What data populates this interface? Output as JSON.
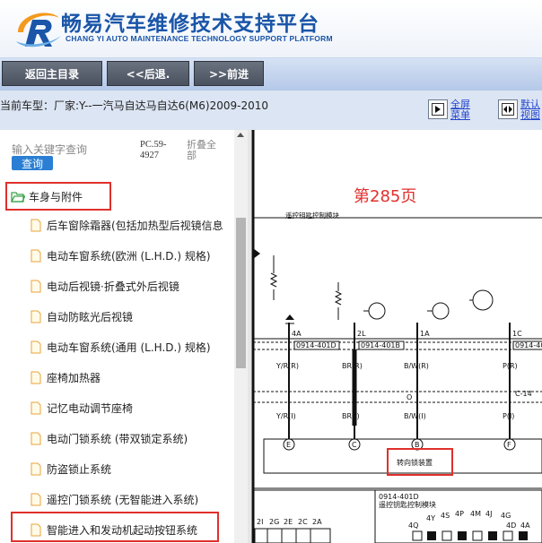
{
  "header": {
    "title_cn": "畅易汽车维修技术支持平台",
    "title_en": "CHANG YI AUTO MAINTENANCE TECHNOLOGY SUPPORT PLATFORM"
  },
  "nav": {
    "home": "返回主目录",
    "back": "<<后退.",
    "forward": ">>前进"
  },
  "vehicle": {
    "text": "当前车型：厂家:Y--一汽马自达马自达6(M6)2009-2010"
  },
  "tools": {
    "fullscreen_line1": "全屏",
    "fullscreen_line2": "菜单",
    "default_line1": "默认",
    "default_line2": "视图"
  },
  "search": {
    "placeholder": "输入关键字查询",
    "button": "查询",
    "pc_line1": "PC.59-",
    "pc_line2": "4927",
    "fold_line1": "折叠全",
    "fold_line2": "部"
  },
  "tree": {
    "root": "车身与附件",
    "items": [
      "后车窗除霜器(包括加热型后视镜信息",
      "电动车窗系统(欧洲 (L.H.D.) 规格)",
      "电动后视镜·折叠式外后视镜",
      "自动防眩光后视镜",
      "电动车窗系统(通用 (L.H.D.) 规格)",
      "座椅加热器",
      "记忆电动调节座椅",
      "电动门锁系统 (带双锁定系统)",
      "防盗锁止系统",
      "遥控门锁系统 (无智能进入系统)",
      "智能进入和发动机起动按钮系统"
    ]
  },
  "diagram": {
    "page": "第285页",
    "section": "遥控钥匙控制模块",
    "pins": [
      "4A",
      "2L",
      "1A",
      "1C"
    ],
    "connectors": [
      "0914-401D",
      "0914-401B",
      "0914-401"
    ],
    "wires_top": [
      "Y/R(R)",
      "BR(R)",
      "B/W(R)",
      "P(R)"
    ],
    "wires_bottom": [
      "Y/R(I)",
      "BR(I)",
      "B/W(I)",
      "P(I)"
    ],
    "terminals": [
      "E",
      "C",
      "B",
      "F"
    ],
    "junction": "C-14",
    "o_label": "O",
    "lock_unit": "转向锁装置",
    "lower_connector": "0914-401D",
    "lower_module": "遥控钥匙控制模块",
    "lower_pins_left": [
      "2I",
      "2G",
      "2E",
      "2C",
      "2A"
    ],
    "lower_pins_right": [
      "4Y",
      "4S",
      "4P",
      "4M",
      "4J",
      "4G"
    ],
    "lower_pins_right2": [
      "4Q",
      "4D",
      "4A"
    ]
  },
  "colors": {
    "brand_blue": "#1a55a8",
    "highlight_red": "#e0302c",
    "nav_button": "#5a6270"
  }
}
